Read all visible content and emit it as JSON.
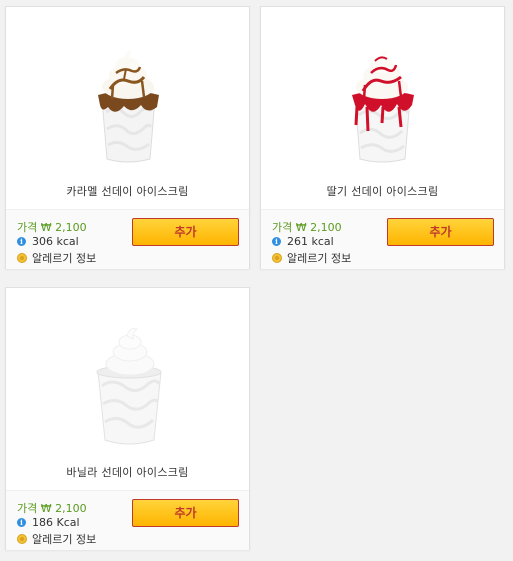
{
  "products": [
    {
      "name": "카라멜 선데이 아이스크림",
      "price": "가격 ₩ 2,100",
      "kcal": "306 kcal",
      "allergy": "알레르기 정보",
      "add_label": "추가",
      "topping_color": "#7a4a1e"
    },
    {
      "name": "딸기 선데이 아이스크림",
      "price": "가격 ₩ 2,100",
      "kcal": "261 kcal",
      "allergy": "알레르기 정보",
      "add_label": "추가",
      "topping_color": "#d0102a"
    },
    {
      "name": "바닐라 선데이 아이스크림",
      "price": "가격 ₩ 2,100",
      "kcal": "186 Kcal",
      "allergy": "알레르기 정보",
      "add_label": "추가",
      "topping_color": ""
    }
  ],
  "colors": {
    "price_text": "#5a9b1f",
    "button_fill": "#ffc21a",
    "button_text": "#c0392b",
    "info_icon": "#2f8fe0",
    "allergy_icon": "#f3c237"
  }
}
